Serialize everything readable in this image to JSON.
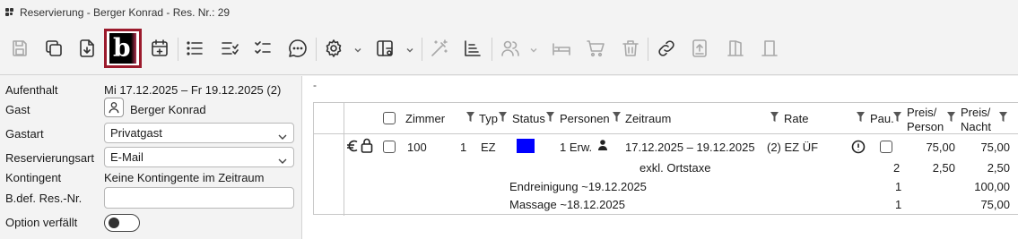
{
  "window": {
    "title": "Reservierung - Berger Konrad - Res. Nr.: 29"
  },
  "toolbar": {
    "items": [
      "save-icon",
      "copy-icon",
      "download-icon",
      "b-logo-button",
      "calendar-add-icon",
      "list-icon",
      "list-check-icon",
      "checklist-icon",
      "chat-icon",
      "settings-icon",
      "layout-icon",
      "magic-wand-icon",
      "chart-icon",
      "users-icon",
      "bed-icon",
      "cart-icon",
      "delete-icon",
      "link-icon",
      "upload-icon",
      "door-open-icon",
      "door-icon"
    ],
    "logo_letter": "b",
    "accent": "#9b1a2c"
  },
  "form": {
    "aufenthalt_label": "Aufenthalt",
    "aufenthalt_value": "Mi 17.12.2025 – Fr 19.12.2025 (2)",
    "gast_label": "Gast",
    "gast_value": "Berger Konrad",
    "gastart_label": "Gastart",
    "gastart_value": "Privatgast",
    "resart_label": "Reservierungsart",
    "resart_value": "E-Mail",
    "kontingent_label": "Kontingent",
    "kontingent_value": "Keine Kontingente im Zeitraum",
    "bdef_label": "B.def. Res.-Nr.",
    "bdef_value": "",
    "option_label": "Option verfällt",
    "option_on": false
  },
  "main": {
    "dash": "-"
  },
  "table": {
    "headers": {
      "zimmer": "Zimmer",
      "typ": "Typ",
      "status": "Status",
      "personen": "Personen",
      "zeitraum": "Zeitraum",
      "rate": "Rate",
      "pau": "Pau.",
      "preis_person_1": "Preis/",
      "preis_person_2": "Person",
      "preis_nacht_1": "Preis/",
      "preis_nacht_2": "Nacht"
    },
    "row": {
      "zimmer": "100",
      "num": "1",
      "typ": "EZ",
      "status_color": "#0000ff",
      "personen": "1 Erw.",
      "zeitraum": "17.12.2025 – 19.12.2025",
      "rate": "(2) EZ ÜF",
      "preis_person": "75,00",
      "preis_nacht": "75,00"
    },
    "subrows": [
      {
        "text": "exkl. Ortstaxe",
        "qty": "2",
        "person": "2,50",
        "nacht": "2,50"
      },
      {
        "text": "Endreinigung ~19.12.2025",
        "qty": "1",
        "person": "",
        "nacht": "100,00"
      },
      {
        "text": "Massage ~18.12.2025",
        "qty": "1",
        "person": "",
        "nacht": "75,00"
      }
    ]
  }
}
